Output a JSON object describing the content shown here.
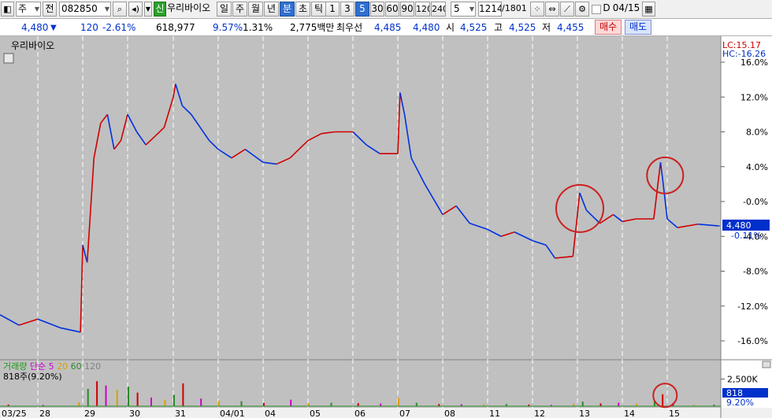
{
  "toolbar": {
    "market": "주",
    "period_label": "전",
    "code": "082850",
    "badge": "신",
    "stock_name": "우리바이오",
    "periods": [
      "일",
      "주",
      "월",
      "년",
      "분",
      "초",
      "틱"
    ],
    "active_period": "분",
    "minutes": [
      "1",
      "3",
      "5",
      "30",
      "60",
      "90",
      "120",
      "240"
    ],
    "active_minute": "5",
    "interval_value": "5",
    "count": "1214",
    "total": "/1801",
    "d_label": "D",
    "date": "04/15"
  },
  "quote": {
    "price": "4,480",
    "change": "120",
    "change_pct": "-2.61%",
    "volume": "618,977",
    "volume_pct": "9.57%",
    "turnover_pct": "1.31%",
    "amount": "2,775백만",
    "best_label": "최우선",
    "best_ask": "4,485",
    "best_bid": "4,480",
    "open_label": "시",
    "open": "4,525",
    "high_label": "고",
    "high": "4,525",
    "low_label": "저",
    "low": "4,455",
    "buy_label": "매수",
    "sell_label": "매도"
  },
  "colors": {
    "up": "#d00000",
    "down": "#0030e0",
    "chart_bg": "#c0c0c0",
    "annotation": "#cc2020"
  },
  "chart_data": {
    "type": "line",
    "title": "우리바이오",
    "lc_label": "LC:15.17",
    "hc_label": "HC:-16.26",
    "y_ticks": [
      "16.0%",
      "12.0%",
      "8.0%",
      "4.0%",
      "-0.0%",
      "-4.0%",
      "-8.0%",
      "-12.0%",
      "-16.0%"
    ],
    "ylim": [
      -17.3,
      17.2
    ],
    "x_labels": [
      "03/25",
      "28",
      "29",
      "30",
      "31",
      "04/01",
      "04",
      "05",
      "06",
      "07",
      "08",
      "11",
      "12",
      "13",
      "14",
      "15"
    ],
    "current_price": "4,480",
    "current_pct": "-0.11%",
    "series": [
      {
        "x": [
          0,
          0.5,
          1,
          1.5,
          1.95,
          2,
          2.1,
          2.25,
          2.4,
          2.55,
          2.7,
          2.85,
          3,
          3.2,
          3.4,
          3.6,
          3.8,
          4,
          4.05,
          4.2,
          4.4,
          4.6,
          4.8,
          5,
          5.3,
          5.6,
          6,
          6.3,
          6.6,
          7,
          7.3,
          7.6,
          8,
          8.3,
          8.6,
          9,
          9.05,
          9.15,
          9.3,
          9.6,
          10,
          10.3,
          10.6,
          11,
          11.3,
          11.6,
          12,
          12.3,
          12.5,
          12.9,
          13,
          13.05,
          13.2,
          13.5,
          13.8,
          14,
          14.3,
          14.7,
          14.85,
          14.9,
          15,
          15.2,
          15.6,
          16
        ],
        "values": [
          -13,
          -14.2,
          -13.5,
          -14.5,
          -15,
          -5,
          -7,
          5,
          9,
          10,
          6,
          7,
          10,
          8,
          6.5,
          7.5,
          8.5,
          12,
          13.5,
          11,
          10,
          8.5,
          7,
          6,
          5,
          6,
          4.5,
          4.3,
          5,
          7,
          7.8,
          8,
          8,
          6.5,
          5.5,
          5.5,
          12.5,
          10,
          5,
          2,
          -1.5,
          -0.5,
          -2.5,
          -3.2,
          -4,
          -3.5,
          -4.5,
          -5,
          -6.5,
          -6.3,
          -1.5,
          1,
          -1,
          -2.5,
          -1.5,
          -2.3,
          -2,
          -2,
          4.5,
          2.5,
          -2,
          -3,
          -2.6,
          -2.8
        ]
      }
    ],
    "volume": {
      "title": "거래량",
      "legend": [
        "단순 5",
        "20",
        "60",
        "120"
      ],
      "info": "818주(9.20%)",
      "ticks": [
        "2,500K",
        "0"
      ],
      "current": "818",
      "current_pct": "9.20%",
      "max": 2900,
      "x": [
        0.2,
        1.1,
        1.9,
        2.1,
        2.3,
        2.5,
        2.75,
        3,
        3.2,
        3.5,
        3.8,
        4,
        4.2,
        4.6,
        5,
        5.5,
        6,
        6.6,
        7,
        7.5,
        8.1,
        8.6,
        9,
        9.4,
        9.9,
        10.4,
        10.9,
        11.4,
        11.9,
        12.4,
        12.9,
        13.1,
        13.5,
        13.9,
        14.3,
        14.7,
        14.88,
        15.1,
        15.5,
        15.9
      ],
      "values": [
        150,
        120,
        350,
        1600,
        2300,
        1900,
        1500,
        1800,
        1250,
        800,
        600,
        1050,
        2100,
        700,
        500,
        450,
        300,
        600,
        260,
        320,
        280,
        250,
        750,
        320,
        200,
        180,
        170,
        200,
        150,
        120,
        220,
        420,
        260,
        320,
        240,
        520,
        1100,
        300,
        120,
        150
      ]
    },
    "annotations": [
      {
        "cx": 13,
        "cy": -0.8,
        "r": "large"
      },
      {
        "cx": 14.9,
        "cy": 3,
        "r": "medium"
      },
      {
        "cx": 14.9,
        "cy_volume": 1000,
        "r": "small"
      }
    ]
  }
}
